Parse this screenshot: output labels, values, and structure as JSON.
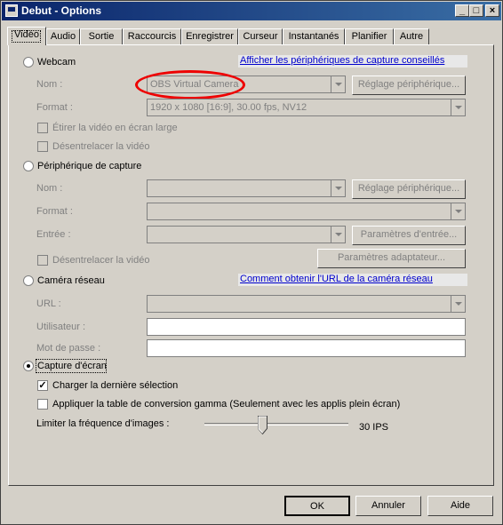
{
  "window": {
    "title": "Debut - Options",
    "min": "_",
    "max": "□",
    "close": "×"
  },
  "tabs": [
    "Vidéo",
    "Audio",
    "Sortie",
    "Raccourcis",
    "Enregistrer",
    "Curseur",
    "Instantanés",
    "Planifier",
    "Autre"
  ],
  "active_tab": "Vidéo",
  "webcam": {
    "radio_label": "Webcam",
    "link": "Afficher les périphériques de capture conseillés",
    "name_label": "Nom :",
    "name_value": "OBS Virtual Camera",
    "device_settings_button": "Réglage périphérique...",
    "format_label": "Format :",
    "format_value": "1920 x 1080 [16:9], 30.00 fps, NV12",
    "stretch_label": "Étirer la vidéo en écran large",
    "deinterlace_label": "Désentrelacer la vidéo"
  },
  "capture_device": {
    "radio_label": "Périphérique de capture",
    "name_label": "Nom :",
    "device_settings_button": "Réglage périphérique...",
    "format_label": "Format :",
    "input_label": "Entrée :",
    "input_params_button": "Paramètres d'entrée...",
    "deinterlace_label": "Désentrelacer la vidéo",
    "adapter_params_button": "Paramètres adaptateur..."
  },
  "network_camera": {
    "radio_label": "Caméra réseau",
    "link": "Comment obtenir l'URL de la caméra réseau",
    "url_label": "URL :",
    "user_label": "Utilisateur :",
    "password_label": "Mot de passe :"
  },
  "screen_capture": {
    "radio_label": "Capture d'écran",
    "load_last_label": "Charger la dernière sélection",
    "load_last_checked": true,
    "gamma_label": "Appliquer la table de conversion gamma (Seulement avec les applis plein écran)",
    "gamma_checked": false
  },
  "framerate": {
    "label": "Limiter la fréquence d'images :",
    "value_text": "30 IPS",
    "slider_fraction": 0.4
  },
  "footer": {
    "ok": "OK",
    "cancel": "Annuler",
    "help": "Aide"
  },
  "annotation_color": "#e00000"
}
